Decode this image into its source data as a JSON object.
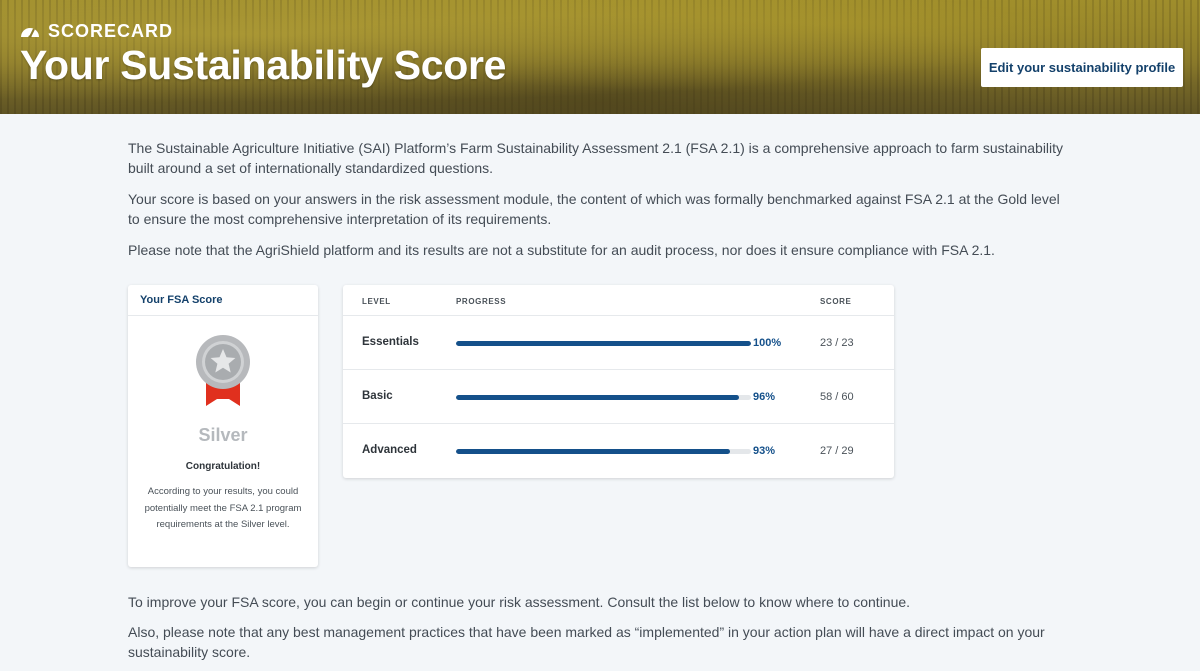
{
  "header": {
    "label": "SCORECARD",
    "title": "Your Sustainability Score",
    "edit_button": "Edit your sustainability profile"
  },
  "intro": [
    "The Sustainable Agriculture Initiative (SAI) Platform’s Farm Sustainability Assessment 2.1 (FSA 2.1) is a comprehensive approach to farm sustainability built around a set of internationally standardized questions.",
    "Your score is based on your answers in the risk assessment module, the content of which was formally benchmarked against FSA 2.1 at the Gold level to ensure the most comprehensive interpretation of its requirements.",
    "Please note that the AgriShield platform and its results are not a substitute for an audit process, nor does it ensure compliance with FSA 2.1."
  ],
  "score_card": {
    "title": "Your FSA Score",
    "level": "Silver",
    "congrats": "Congratulation!",
    "description": "According to your results, you could potentially meet the FSA 2.1 program requirements at the Silver level."
  },
  "progress_table": {
    "headers": {
      "level": "LEVEL",
      "progress": "PROGRESS",
      "score": "SCORE"
    },
    "rows": [
      {
        "label": "Essentials",
        "percent": 100,
        "percent_text": "100%",
        "score": "23 / 23"
      },
      {
        "label": "Basic",
        "percent": 96,
        "percent_text": "96%",
        "score": "58 / 60"
      },
      {
        "label": "Advanced",
        "percent": 93,
        "percent_text": "93%",
        "score": "27 / 29"
      }
    ]
  },
  "outro": [
    "To improve your FSA score, you can begin or continue your risk assessment. Consult the list below to know where to continue.",
    "Also, please note that any best management practices that have been marked as “implemented” in your action plan will have a direct impact on your sustainability score."
  ],
  "colors": {
    "accent": "#14508a",
    "heading_blue": "#14416b",
    "silver": "#b5b9bd",
    "ribbon_red": "#e0301e"
  },
  "icons": {
    "header_icon": "gauge-icon",
    "medal_icon": "silver-medal-icon"
  }
}
